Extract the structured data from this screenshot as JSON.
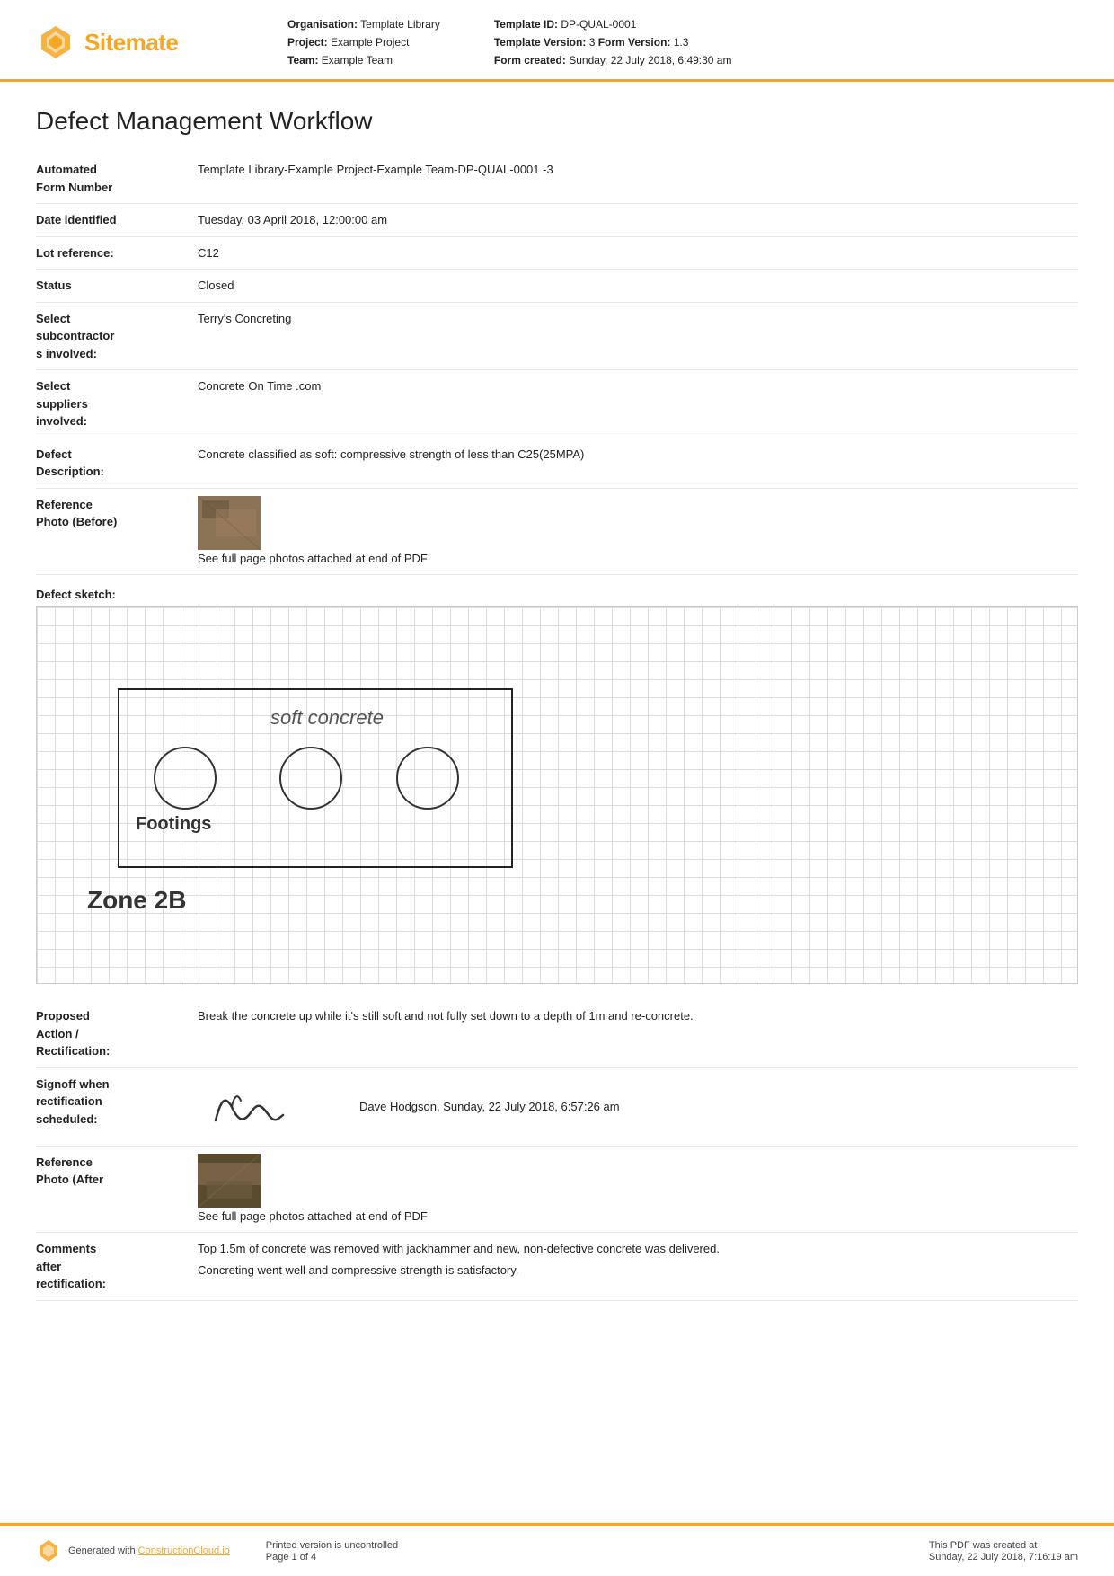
{
  "header": {
    "logo_text_main": "Sitemate",
    "org_label": "Organisation:",
    "org_value": "Template Library",
    "project_label": "Project:",
    "project_value": "Example Project",
    "team_label": "Team:",
    "team_value": "Example Team",
    "template_id_label": "Template ID:",
    "template_id_value": "DP-QUAL-0001",
    "template_version_label": "Template Version:",
    "template_version_value": "3",
    "form_version_label": "Form Version:",
    "form_version_value": "1.3",
    "form_created_label": "Form created:",
    "form_created_value": "Sunday, 22 July 2018, 6:49:30 am"
  },
  "doc": {
    "title": "Defect Management Workflow",
    "fields": [
      {
        "label": "Automated Form Number",
        "value": "Template Library-Example Project-Example Team-DP-QUAL-0001   -3"
      },
      {
        "label": "Date identified",
        "value": "Tuesday, 03 April 2018, 12:00:00 am"
      },
      {
        "label": "Lot reference:",
        "value": "C12"
      },
      {
        "label": "Status",
        "value": "Closed"
      },
      {
        "label": "Select subcontractors involved:",
        "value": "Terry's Concreting"
      },
      {
        "label": "Select suppliers involved:",
        "value": "Concrete On Time .com"
      },
      {
        "label": "Defect Description:",
        "value": "Concrete classified as soft: compressive strength of less than C25(25MPA)"
      },
      {
        "label": "Reference Photo (Before)",
        "value": "",
        "has_image": true,
        "photo_note": "See full page photos attached at end of PDF"
      }
    ],
    "sketch_label": "Defect sketch:",
    "sketch_soft_text": "soft concrete",
    "sketch_footings_text": "Footings",
    "sketch_zone_text": "Zone 2B",
    "proposed_action_label": "Proposed Action / Rectification:",
    "proposed_action_value": "Break the concrete up while it's still soft and not fully set down to a depth of 1m and re-concrete.",
    "signoff_label": "Signoff when rectification scheduled:",
    "signoff_person": "Dave Hodgson, Sunday, 22 July 2018, 6:57:26 am",
    "ref_photo_after_label": "Reference Photo (After)",
    "ref_photo_after_note": "See full page photos attached at end of PDF",
    "comments_label": "Comments after rectification:",
    "comments_line1": "Top 1.5m of concrete was removed with jackhammer and new, non-defective concrete was delivered.",
    "comments_line2": "Concreting went well and compressive strength is satisfactory."
  },
  "footer": {
    "generated_text": "Generated with",
    "link_text": "ConstructionCloud.io",
    "uncontrolled_text": "Printed version is uncontrolled",
    "page_text": "Page 1 of 4",
    "pdf_created_label": "This PDF was created at",
    "pdf_created_value": "Sunday, 22 July 2018, 7:16:19 am"
  }
}
